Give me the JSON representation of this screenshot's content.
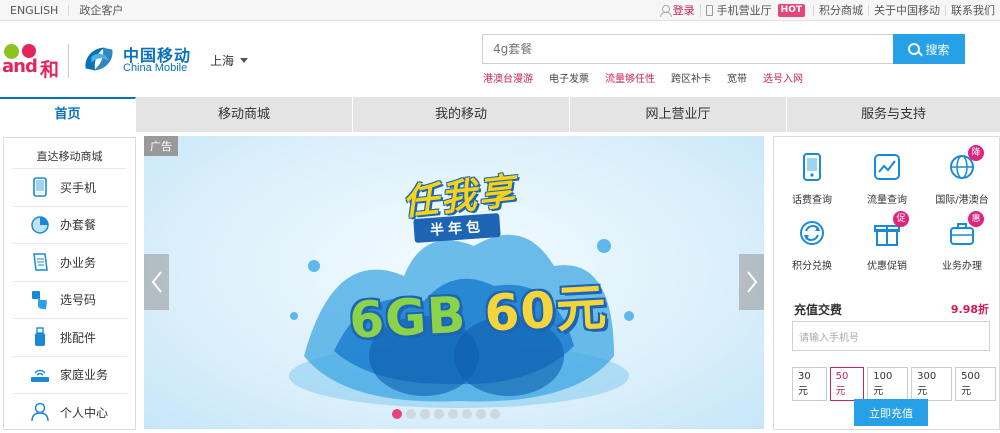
{
  "topbar": {
    "left": [
      "ENGLISH",
      "政企客户"
    ],
    "login": "登录",
    "app": "手机营业厅",
    "hot_badge": "HOT",
    "mall": "积分商城",
    "about": "关于中国移动",
    "contact": "联系我们"
  },
  "header": {
    "brand_he": "and",
    "brand_he_char": "和",
    "brand_cn": "中国移动",
    "brand_en": "China Mobile",
    "city": "上海",
    "search_placeholder": "4g套餐",
    "search_btn": "搜索",
    "hotwords": [
      {
        "text": "港澳台漫游",
        "highlight": true
      },
      {
        "text": "电子发票",
        "highlight": false
      },
      {
        "text": "流量够任性",
        "highlight": true
      },
      {
        "text": "跨区补卡",
        "highlight": false
      },
      {
        "text": "宽带",
        "highlight": false
      },
      {
        "text": "选号入网",
        "highlight": true
      }
    ]
  },
  "nav": [
    "首页",
    "移动商城",
    "我的移动",
    "网上营业厅",
    "服务与支持"
  ],
  "sidebar": {
    "title": "直达移动商城",
    "items": [
      {
        "label": "买手机",
        "icon": "phone-icon"
      },
      {
        "label": "办套餐",
        "icon": "package-icon"
      },
      {
        "label": "办业务",
        "icon": "document-icon"
      },
      {
        "label": "选号码",
        "icon": "hand-tap-icon"
      },
      {
        "label": "挑配件",
        "icon": "usb-icon"
      },
      {
        "label": "家庭业务",
        "icon": "router-icon"
      },
      {
        "label": "个人中心",
        "icon": "person-icon"
      }
    ]
  },
  "banner": {
    "ad_tag": "广告",
    "headline": "任我享",
    "subline": "半年包",
    "price_gb": "6GB",
    "price_yuan": "60元",
    "dots": 8,
    "active_dot": 0
  },
  "services": [
    {
      "label": "话费查询",
      "icon": "phone-bill-icon",
      "badge": ""
    },
    {
      "label": "流量查询",
      "icon": "traffic-chart-icon",
      "badge": ""
    },
    {
      "label": "国际/港澳台",
      "icon": "globe-icon",
      "badge": "降"
    },
    {
      "label": "积分兑换",
      "icon": "refresh-icon",
      "badge": ""
    },
    {
      "label": "优惠促销",
      "icon": "gift-icon",
      "badge": "促"
    },
    {
      "label": "业务办理",
      "icon": "briefcase-icon",
      "badge": "惠"
    }
  ],
  "recharge": {
    "title": "充值交费",
    "discount": "9.98折",
    "input_placeholder": "请输入手机号",
    "amounts": [
      "30元",
      "50元",
      "100元",
      "300元",
      "500元"
    ],
    "selected": 1,
    "button": "立即充值"
  },
  "colors": {
    "brand_blue": "#0a72b8",
    "accent_pink": "#c8245c",
    "button_blue": "#26a0e7"
  }
}
